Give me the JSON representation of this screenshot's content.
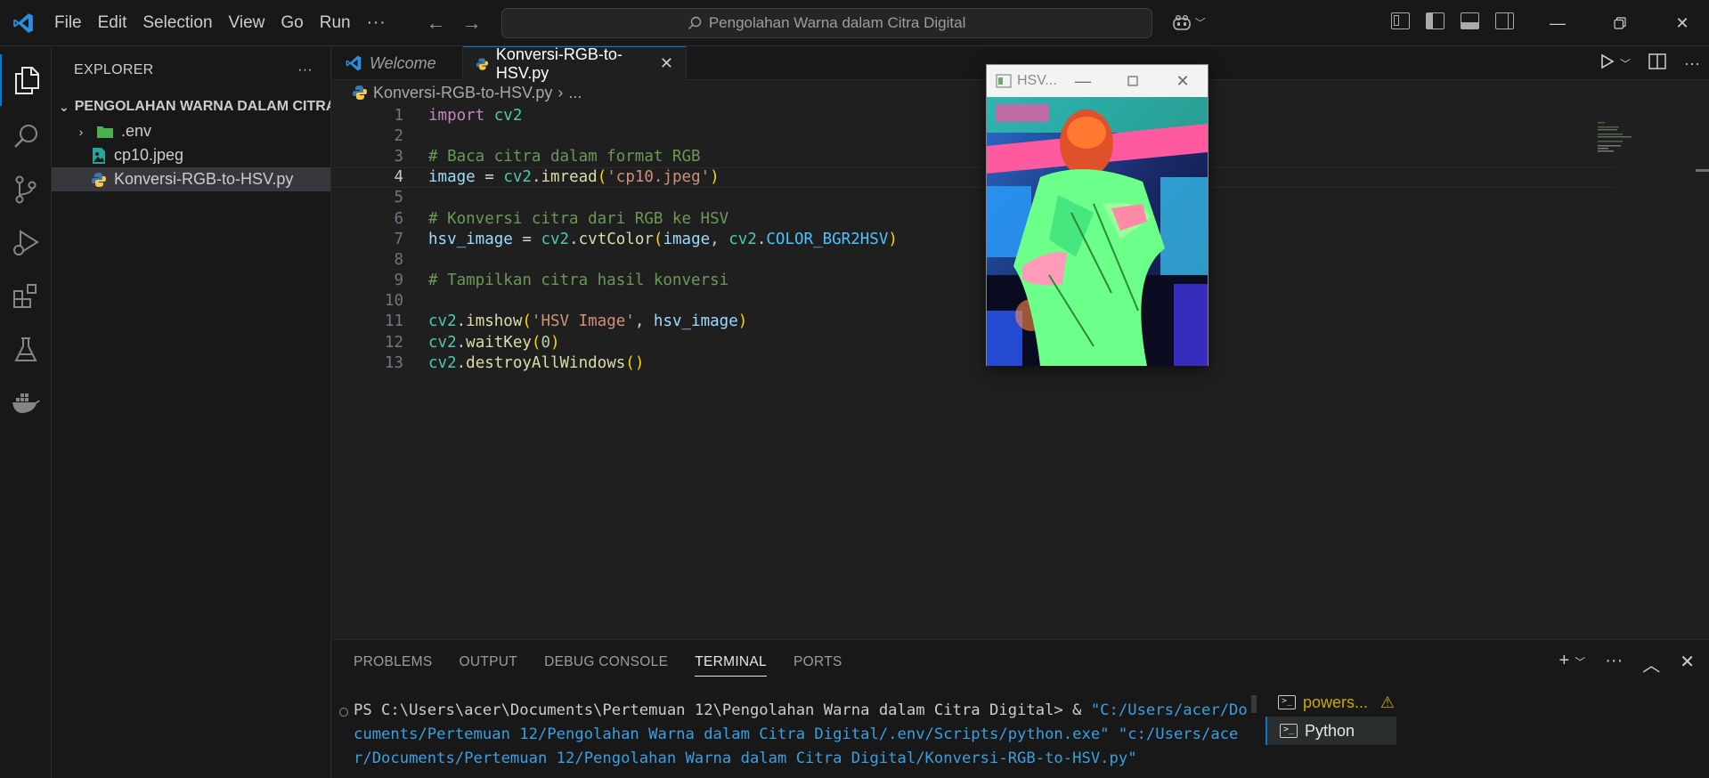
{
  "menu": {
    "items": [
      "File",
      "Edit",
      "Selection",
      "View",
      "Go",
      "Run"
    ],
    "more": "···"
  },
  "search": {
    "text": "Pengolahan Warna dalam Citra Digital"
  },
  "sidebar": {
    "title": "EXPLORER",
    "more": "···",
    "folder": "PENGOLAHAN WARNA DALAM CITRA DI...",
    "items": [
      {
        "label": ".env",
        "type": "folder"
      },
      {
        "label": "cp10.jpeg",
        "type": "image"
      },
      {
        "label": "Konversi-RGB-to-HSV.py",
        "type": "python",
        "selected": true
      }
    ]
  },
  "tabs": [
    {
      "label": "Welcome",
      "icon": "vscode-icon",
      "active": false
    },
    {
      "label": "Konversi-RGB-to-HSV.py",
      "icon": "python-icon",
      "active": true,
      "close": "✕"
    }
  ],
  "breadcrumb": {
    "file": "Konversi-RGB-to-HSV.py",
    "rest": "..."
  },
  "editor": {
    "current_line": 4,
    "line_numbers": [
      "1",
      "2",
      "3",
      "4",
      "5",
      "6",
      "7",
      "8",
      "9",
      "10",
      "11",
      "12",
      "13"
    ],
    "lines": [
      "import cv2",
      "",
      "# Baca citra dalam format RGB",
      "image = cv2.imread('cp10.jpeg')",
      "",
      "# Konversi citra dari RGB ke HSV",
      "hsv_image = cv2.cvtColor(image, cv2.COLOR_BGR2HSV)",
      "",
      "# Tampilkan citra hasil konversi",
      "",
      "cv2.imshow('HSV Image', hsv_image)",
      "cv2.waitKey(0)",
      "cv2.destroyAllWindows()"
    ]
  },
  "hsv_window": {
    "title": "HSV...",
    "minimize": "—",
    "close": "✕"
  },
  "panel": {
    "tabs": [
      "PROBLEMS",
      "OUTPUT",
      "DEBUG CONSOLE",
      "TERMINAL",
      "PORTS"
    ],
    "active_tab": "TERMINAL",
    "terminal": {
      "prompt": "PS C:\\Users\\acer\\Documents\\Pertemuan 12\\Pengolahan Warna dalam Citra Digital> & ",
      "cmd": "\"C:/Users/acer/Documents/Pertemuan 12/Pengolahan Warna dalam Citra Digital/.env/Scripts/python.exe\" \"c:/Users/acer/Documents/Pertemuan 12/Pengolahan Warna dalam Citra Digital/Konversi-RGB-to-HSV.py\""
    },
    "terminals": [
      {
        "label": "powers...",
        "warning": "⚠"
      },
      {
        "label": "Python",
        "selected": true
      }
    ]
  },
  "colors": {
    "accent": "#0078d4",
    "bg": "#1f1f1f",
    "sidebar_bg": "#181818"
  }
}
